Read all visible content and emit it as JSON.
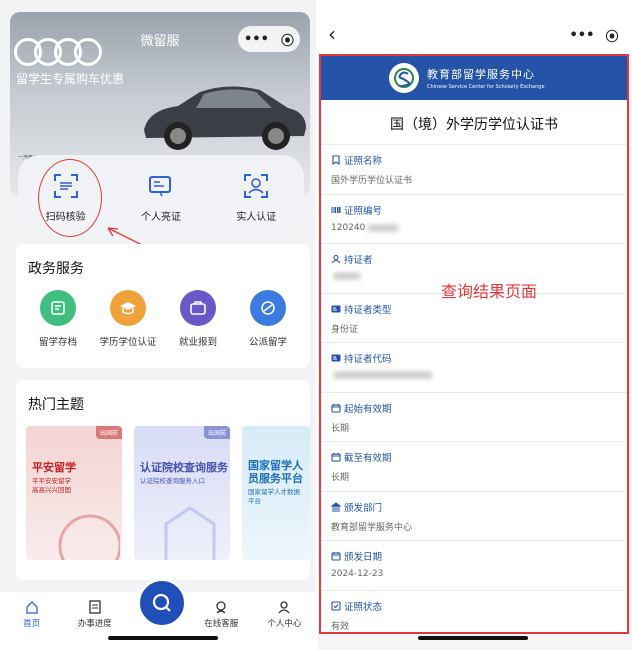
{
  "left": {
    "mini_title": "微留服",
    "capsule": {
      "more": "•••",
      "close": "⦿"
    },
    "banner": {
      "slogan": "留学生专属购车优惠",
      "caption": "一汽奥迪"
    },
    "quick_actions": [
      {
        "label": "扫码核验",
        "icon": "scan-icon"
      },
      {
        "label": "个人亮证",
        "icon": "id-card-icon"
      },
      {
        "label": "实人认证",
        "icon": "face-verify-icon"
      }
    ],
    "gov": {
      "title": "政务服务",
      "items": [
        {
          "label": "留学存档",
          "icon": "archive-icon",
          "color": "#3fbf7f"
        },
        {
          "label": "学历学位认证",
          "icon": "graduation-cap-icon",
          "color": "#f0a23a"
        },
        {
          "label": "就业报到",
          "icon": "briefcase-icon",
          "color": "#6a57c9"
        },
        {
          "label": "公派留学",
          "icon": "plane-icon",
          "color": "#3b7be0"
        }
      ]
    },
    "topics": {
      "title": "热门主题",
      "items": [
        {
          "tag": "出国前",
          "title": "平安留学",
          "sub": "平平安安留学\n高高兴兴回国"
        },
        {
          "tag": "出国前",
          "title": "认证院校查询服务",
          "sub": "认证院校查询服务入口"
        },
        {
          "tag": "",
          "title": "国家留学人员服务平台",
          "sub": "国家留学人才数据平台"
        }
      ]
    },
    "nav": [
      {
        "label": "首页",
        "icon": "home-icon",
        "active": true
      },
      {
        "label": "办事进度",
        "icon": "progress-icon",
        "active": false
      },
      {
        "label": "在线客服",
        "icon": "customer-service-icon",
        "active": false
      },
      {
        "label": "个人中心",
        "icon": "user-icon",
        "active": false
      }
    ]
  },
  "right": {
    "back": "‹",
    "capsule": {
      "more": "•••",
      "close": "⦿"
    },
    "org": {
      "cn": "教育部留学服务中心",
      "en": "Chinese Service Center for Scholarly Exchange"
    },
    "doc_title": "国（境）外学历学位认证书",
    "annotation": "查询结果页面",
    "fields": [
      {
        "label": "证照名称",
        "value": "国外学历学位认证书",
        "icon": "bookmark-icon",
        "blur": 0
      },
      {
        "label": "证照编号",
        "value": "120240",
        "icon": "barcode-icon",
        "blur": 32
      },
      {
        "label": "持证者",
        "value": "",
        "icon": "person-icon",
        "blur": 28
      },
      {
        "label": "持证者类型",
        "value": "身份证",
        "icon": "id-card-icon",
        "blur": 0
      },
      {
        "label": "持证者代码",
        "value": "",
        "icon": "id-card-icon",
        "blur": 100
      },
      {
        "label": "起始有效期",
        "value": "长期",
        "icon": "calendar-icon",
        "blur": 0
      },
      {
        "label": "截至有效期",
        "value": "长期",
        "icon": "calendar-icon",
        "blur": 0
      },
      {
        "label": "颁发部门",
        "value": "教育部留学服务中心",
        "icon": "bank-icon",
        "blur": 0
      },
      {
        "label": "颁发日期",
        "value": "2024-12-23",
        "icon": "calendar-icon",
        "blur": 0
      },
      {
        "label": "证照状态",
        "value": "有效",
        "icon": "check-box-icon",
        "blur": 0
      }
    ]
  }
}
